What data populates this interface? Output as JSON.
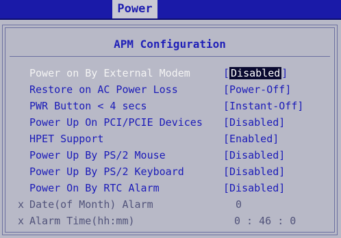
{
  "tabs": {
    "active": "Power"
  },
  "page": {
    "title": "APM Configuration"
  },
  "settings": [
    {
      "label": "Power on By External Modem",
      "value": "Disabled",
      "active": true
    },
    {
      "label": "Restore on AC Power Loss",
      "value": "Power-Off"
    },
    {
      "label": "PWR Button < 4 secs",
      "value": "Instant-Off"
    },
    {
      "label": "Power Up On PCI/PCIE Devices",
      "value": "Disabled"
    },
    {
      "label": "HPET Support",
      "value": "Enabled"
    },
    {
      "label": "Power Up By PS/2 Mouse",
      "value": "Disabled"
    },
    {
      "label": "Power Up By PS/2 Keyboard",
      "value": "Disabled"
    },
    {
      "label": "Power On By RTC Alarm",
      "value": "Disabled"
    }
  ],
  "disabled_settings": [
    {
      "marker": "x",
      "label": "Date(of Month) Alarm",
      "value": "0"
    },
    {
      "marker": "x",
      "label": "Alarm Time(hh:mm)",
      "value": "0 : 46 : 0"
    }
  ],
  "colors": {
    "background": "#b8b9c7",
    "top_bar": "#1a1aa8",
    "text": "#1a1ab8",
    "selected_text": "#ffffff",
    "selected_bg": "#0a0a30"
  }
}
